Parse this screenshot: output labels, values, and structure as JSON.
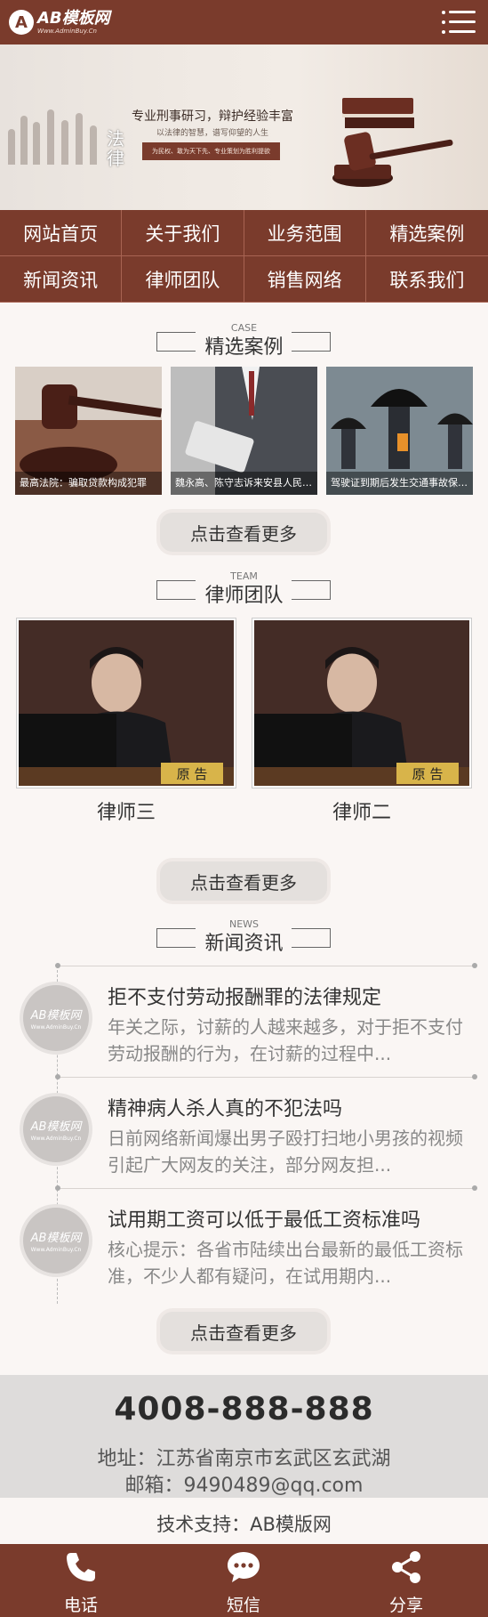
{
  "header": {
    "logo_mark": "A",
    "logo_text": "AB模板网",
    "logo_sub": "Www.AdminBuy.Cn"
  },
  "banner": {
    "calligraphy": "法律",
    "title": "专业刑事研习，辩护经验丰富",
    "subtitle": "以法律的智慧，谱写仰望的人生",
    "pill": "为民权、敢为天下先、专业策划为胜利提欲",
    "active_slide": 1,
    "slides": 3
  },
  "nav": [
    "网站首页",
    "关于我们",
    "业务范围",
    "精选案例",
    "新闻资讯",
    "律师团队",
    "销售网络",
    "联系我们"
  ],
  "cases": {
    "en": "CASE",
    "cn": "精选案例",
    "items": [
      {
        "caption": "最高法院：骗取贷款构成犯罪"
      },
      {
        "caption": "魏永高、陈守志诉来安县人民政府"
      },
      {
        "caption": "驾驶证到期后发生交通事故保险公司"
      }
    ],
    "more": "点击查看更多"
  },
  "team": {
    "en": "TEAM",
    "cn": "律师团队",
    "plaque": "原 告",
    "members": [
      {
        "name": "律师三"
      },
      {
        "name": "律师二"
      }
    ],
    "more": "点击查看更多"
  },
  "news": {
    "en": "NEWS",
    "cn": "新闻资讯",
    "avatar_text": "AB模板网",
    "avatar_sub": "Www.AdminBuy.Cn",
    "items": [
      {
        "title": "拒不支付劳动报酬罪的法律规定",
        "desc": "年关之际，讨薪的人越来越多，对于拒不支付劳动报酬的行为，在讨薪的过程中..."
      },
      {
        "title": "精神病人杀人真的不犯法吗",
        "desc": "日前网络新闻爆出男子殴打扫地小男孩的视频引起广大网友的关注，部分网友担..."
      },
      {
        "title": "试用期工资可以低于最低工资标准吗",
        "desc": "核心提示：各省市陆续出台最新的最低工资标准，不少人都有疑问，在试用期内..."
      }
    ],
    "more": "点击查看更多"
  },
  "contact": {
    "phone": "4008-888-888",
    "address": "地址：江苏省南京市玄武区玄武湖",
    "email": "邮箱：9490489@qq.com"
  },
  "support": "技术支持：AB模版网",
  "bottom": [
    {
      "label": "电话",
      "icon": "phone-icon"
    },
    {
      "label": "短信",
      "icon": "message-icon"
    },
    {
      "label": "分享",
      "icon": "share-icon"
    }
  ],
  "colors": {
    "brand": "#7a3b2c",
    "background": "#faf6f4",
    "footer": "#dedcdb"
  }
}
